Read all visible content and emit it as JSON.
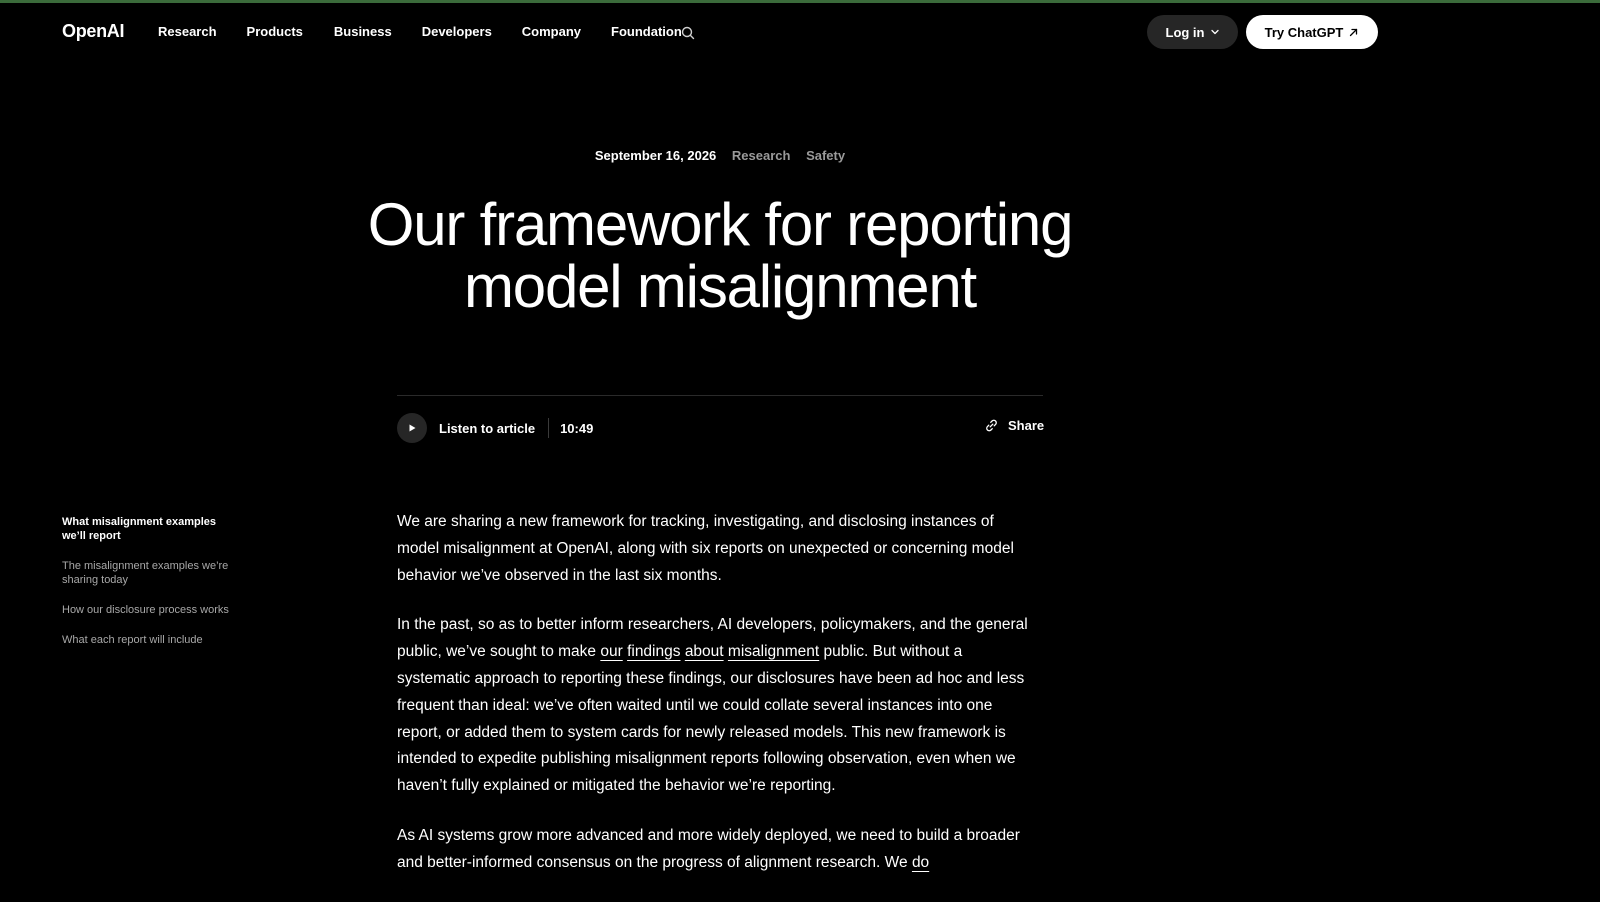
{
  "header": {
    "logo": "OpenAI",
    "nav": [
      "Research",
      "Products",
      "Business",
      "Developers",
      "Company",
      "Foundation"
    ],
    "login_label": "Log in",
    "try_label": "Try ChatGPT"
  },
  "meta": {
    "date": "September 16, 2026",
    "tags": [
      "Research",
      "Safety"
    ]
  },
  "title": {
    "line1": "Our framework for reporting",
    "line2": "model misalignment"
  },
  "audio": {
    "listen_label": "Listen to article",
    "duration": "10:49",
    "share_label": "Share"
  },
  "toc": [
    "What misalignment examples we’ll report",
    "The misalignment examples we’re sharing today",
    "How our disclosure process works",
    "What each report will include"
  ],
  "article": {
    "p1": "We are sharing a new framework for tracking, investigating, and disclosing instances of model misalignment at OpenAI, along with six reports on unexpected or concerning model behavior we’ve observed in the last six months.",
    "p2": {
      "before": "In the past, so as to better inform researchers, AI developers, policymakers, and the general public, we’ve sought to make ",
      "links": [
        "our",
        "findings",
        "about",
        "misalignment"
      ],
      "after": " public. But without a systematic approach to reporting these findings, our disclosures have been ad hoc and less frequent than ideal: we’ve often waited until we could collate several instances into one report, or added them to system cards for newly released models. This new framework is intended to expedite publishing misalignment reports following observation, even when we haven’t fully explained or mitigated the behavior we’re reporting."
    },
    "p3": {
      "before": "As AI systems grow more advanced and more widely deployed, we need to build a broader and better-informed consensus on the progress of alignment research. We ",
      "link": "do"
    }
  },
  "icons": {
    "search": "search-icon",
    "chevron": "chevron-down-icon",
    "arrow": "arrow-up-right-icon",
    "play": "play-icon",
    "link": "link-icon"
  },
  "colors": {
    "background": "#000000",
    "text": "#ffffff",
    "muted": "#9a9a9a",
    "pill": "#262626"
  }
}
